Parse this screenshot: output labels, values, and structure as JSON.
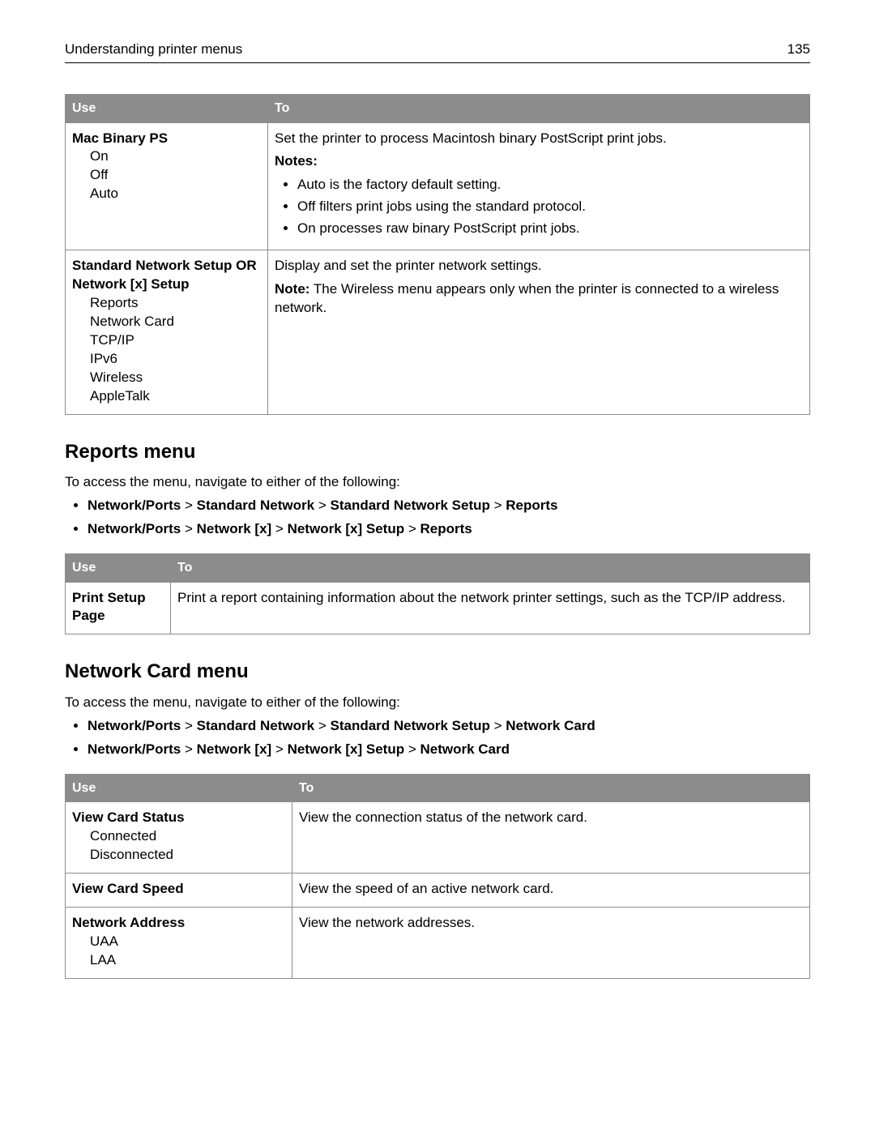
{
  "header": {
    "title": "Understanding printer menus",
    "page_number": "135"
  },
  "table1": {
    "col_use": "Use",
    "col_to": "To",
    "rows": [
      {
        "use_title": "Mac Binary PS",
        "use_opts": [
          "On",
          "Off",
          "Auto"
        ],
        "to_main": "Set the printer to process Macintosh binary PostScript print jobs.",
        "notes_label": "Notes:",
        "notes": [
          "Auto is the factory default setting.",
          "Off filters print jobs using the standard protocol.",
          "On processes raw binary PostScript print jobs."
        ]
      },
      {
        "use_title": "Standard Network Setup OR Network [x] Setup",
        "use_title_line1": "Standard Network Setup OR",
        "use_title_line2": "Network [x] Setup",
        "use_opts": [
          "Reports",
          "Network Card",
          "TCP/IP",
          "IPv6",
          "Wireless",
          "AppleTalk"
        ],
        "to_main": "Display and set the printer network settings.",
        "note_prefix": "Note:",
        "note_text": " The Wireless menu appears only when the printer is connected to a wireless network."
      }
    ]
  },
  "reports_section": {
    "title": "Reports menu",
    "intro": "To access the menu, navigate to either of the following:",
    "paths": [
      [
        "Network/Ports",
        "Standard Network",
        "Standard Network Setup",
        "Reports"
      ],
      [
        "Network/Ports",
        "Network [x]",
        "Network [x] Setup",
        "Reports"
      ]
    ],
    "sep": " > ",
    "table": {
      "col_use": "Use",
      "col_to": "To",
      "rows": [
        {
          "use": "Print Setup Page",
          "to": "Print a report containing information about the network printer settings, such as the TCP/IP address."
        }
      ]
    }
  },
  "networkcard_section": {
    "title": "Network Card menu",
    "intro": "To access the menu, navigate to either of the following:",
    "paths": [
      [
        "Network/Ports",
        "Standard Network",
        "Standard Network Setup",
        "Network Card"
      ],
      [
        "Network/Ports",
        "Network [x]",
        "Network [x] Setup",
        "Network Card"
      ]
    ],
    "sep": " > ",
    "table": {
      "col_use": "Use",
      "col_to": "To",
      "rows": [
        {
          "use_title": "View Card Status",
          "use_opts": [
            "Connected",
            "Disconnected"
          ],
          "to": "View the connection status of the network card."
        },
        {
          "use_title": "View Card Speed",
          "use_opts": [],
          "to": "View the speed of an active network card."
        },
        {
          "use_title": "Network Address",
          "use_opts": [
            "UAA",
            "LAA"
          ],
          "to": "View the network addresses."
        }
      ]
    }
  }
}
